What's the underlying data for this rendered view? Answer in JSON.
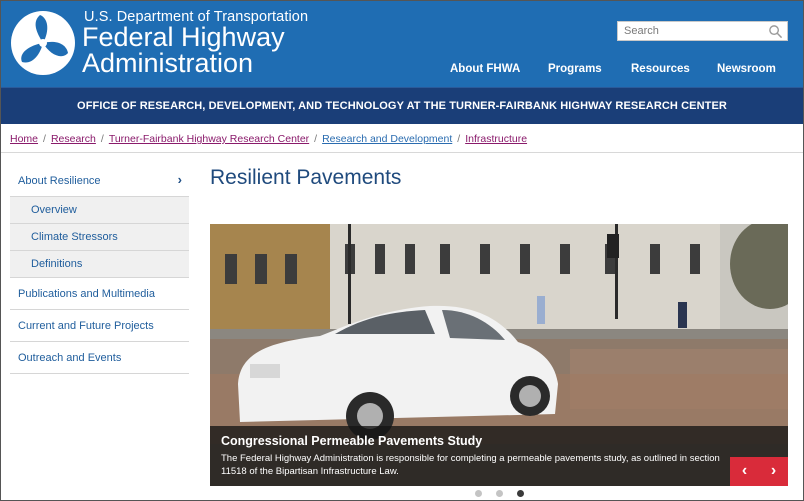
{
  "header": {
    "department": "U.S. Department of Transportation",
    "agency_line1": "Federal Highway",
    "agency_line2": "Administration",
    "logo_icon": "dot-triskelion-logo",
    "search_placeholder": "Search",
    "nav": [
      "About FHWA",
      "Programs",
      "Resources",
      "Newsroom"
    ],
    "brand_color": "#1f6db3"
  },
  "office_bar": {
    "text": "OFFICE OF RESEARCH, DEVELOPMENT, AND TECHNOLOGY AT THE TURNER-FAIRBANK HIGHWAY RESEARCH CENTER",
    "color": "#1a3e78"
  },
  "breadcrumb": [
    "Home",
    "Research",
    "Turner-Fairbank Highway Research Center",
    "Research and Development",
    "Infrastructure"
  ],
  "sidebar": {
    "top": "About Resilience",
    "top_icon": "chevron-right-icon",
    "sub": [
      "Overview",
      "Climate Stressors",
      "Definitions"
    ],
    "items": [
      "Publications and Multimedia",
      "Current and Future Projects",
      "Outreach and Events"
    ]
  },
  "main": {
    "title": "Resilient Pavements",
    "carousel": {
      "slide_title": "Congressional Permeable Pavements Study",
      "slide_text": "The Federal Highway Administration is responsible for completing a permeable pavements study, as outlined in section 11518 of the Bipartisan Infrastructure Law.",
      "prev_icon": "chevron-left-icon",
      "next_icon": "chevron-right-icon",
      "control_color": "#d92b3a",
      "slide_count": 3,
      "active_slide": 3
    }
  }
}
